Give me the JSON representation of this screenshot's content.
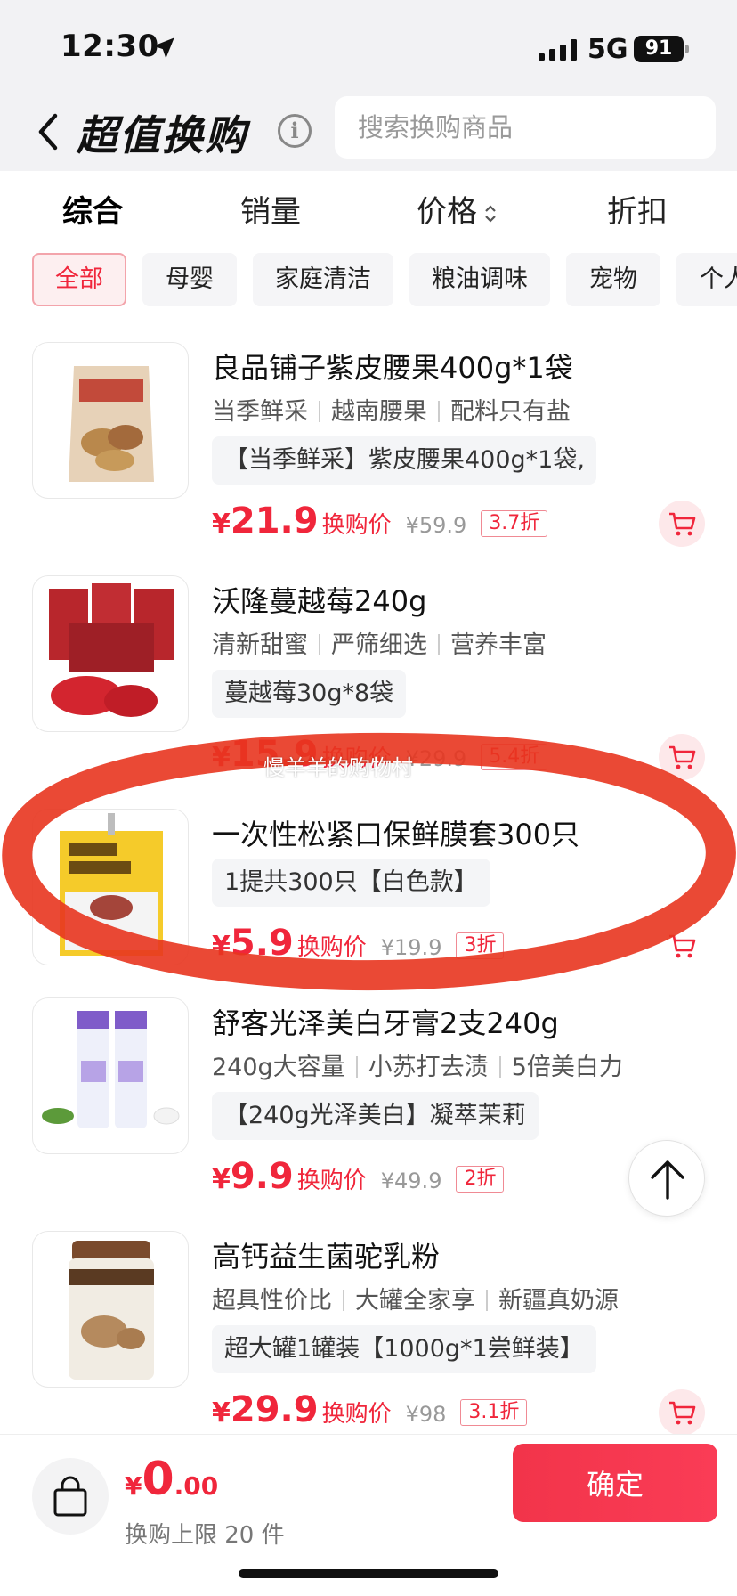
{
  "status": {
    "time": "12:30",
    "network": "5G",
    "battery": "91"
  },
  "header": {
    "title": "超值换购",
    "search_placeholder": "搜索换购商品"
  },
  "sort_tabs": [
    {
      "label": "综合",
      "active": true
    },
    {
      "label": "销量",
      "active": false
    },
    {
      "label": "价格",
      "active": false
    },
    {
      "label": "折扣",
      "active": false
    }
  ],
  "categories": [
    {
      "label": "全部",
      "active": true
    },
    {
      "label": "母婴"
    },
    {
      "label": "家庭清洁"
    },
    {
      "label": "粮油调味"
    },
    {
      "label": "宠物"
    },
    {
      "label": "个人"
    }
  ],
  "products": [
    {
      "title": "良品铺子紫皮腰果400g*1袋",
      "tags": [
        "当季鲜采",
        "越南腰果",
        "配料只有盐"
      ],
      "desc": "【当季鲜采】紫皮腰果400g*1袋,",
      "currency": "¥",
      "price": "21.9",
      "price_label": "换购价",
      "orig_price": "¥59.9",
      "discount": "3.7折",
      "thumb": "cashew-bag-image"
    },
    {
      "title": "沃隆蔓越莓240g",
      "tags": [
        "清新甜蜜",
        "严筛细选",
        "营养丰富"
      ],
      "desc": "蔓越莓30g*8袋",
      "currency": "¥",
      "price": "15.9",
      "price_label": "换购价",
      "orig_price": "¥29.9",
      "discount": "5.4折",
      "thumb": "cranberry-packs-image"
    },
    {
      "title": "一次性松紧口保鲜膜套300只",
      "tags": [],
      "desc": "1提共300只【白色款】",
      "currency": "¥",
      "price": "5.9",
      "price_label": "换购价",
      "orig_price": "¥19.9",
      "discount": "3折",
      "thumb": "cling-film-bag-image"
    },
    {
      "title": "舒客光泽美白牙膏2支240g",
      "tags": [
        "240g大容量",
        "小苏打去渍",
        "5倍美白力"
      ],
      "desc": "【240g光泽美白】凝萃茉莉",
      "currency": "¥",
      "price": "9.9",
      "price_label": "换购价",
      "orig_price": "¥49.9",
      "discount": "2折",
      "thumb": "toothpaste-image"
    },
    {
      "title": "高钙益生菌驼乳粉",
      "tags": [
        "超具性价比",
        "大罐全家享",
        "新疆真奶源"
      ],
      "desc": "超大罐1罐装【1000g*1尝鲜装】",
      "currency": "¥",
      "price": "29.9",
      "price_label": "换购价",
      "orig_price": "¥98",
      "discount": "3.1折",
      "thumb": "camel-milk-can-image"
    }
  ],
  "watermark": "慢羊羊的购物村",
  "bottom": {
    "currency": "¥",
    "total_int": "0",
    "total_dec": ".00",
    "limit": "换购上限 20 件",
    "confirm": "确定"
  },
  "colors": {
    "accent": "#f0263b",
    "page_bg": "#f2f2f4"
  }
}
